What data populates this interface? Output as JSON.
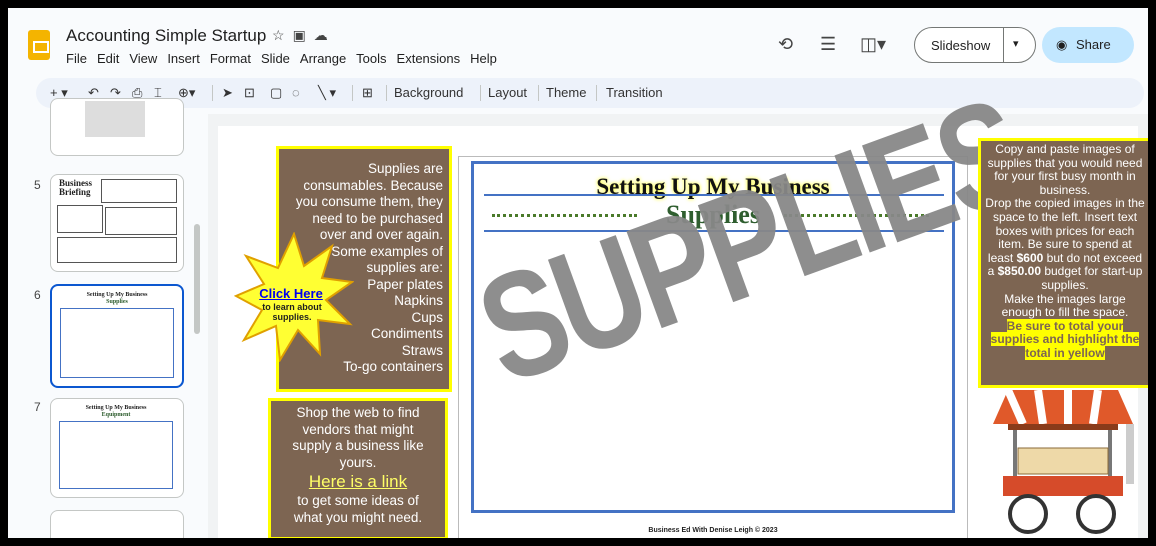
{
  "app": {
    "title": "Accounting Simple Startup",
    "menu": [
      "File",
      "Edit",
      "View",
      "Insert",
      "Format",
      "Slide",
      "Arrange",
      "Tools",
      "Extensions",
      "Help"
    ],
    "slideshow_label": "Slideshow",
    "share_label": "Share",
    "colors": {
      "accent": "#c2e7ff",
      "slide_box": "#7d6552",
      "highlight": "#ffff00",
      "stage_border": "#4472c4"
    }
  },
  "toolbar": {
    "background": "Background",
    "layout": "Layout",
    "theme": "Theme",
    "transition": "Transition"
  },
  "filmstrip": [
    {
      "num": "5",
      "title": "Business Briefing"
    },
    {
      "num": "6",
      "title": "Setting Up My Business",
      "subtitle": "Supplies"
    },
    {
      "num": "7",
      "title": "Setting Up My Business",
      "subtitle": "Equipment"
    }
  ],
  "slide": {
    "left_box_lines": [
      "Supplies are",
      "consumables.  Because",
      "you consume them, they",
      "need to be purchased",
      "over and over again.",
      "Some examples of",
      "supplies are:",
      "Paper plates",
      "Napkins",
      "Cups",
      "Condiments",
      "Straws",
      "To-go containers"
    ],
    "burst_link": "Click Here",
    "burst_text": "to learn about supplies.",
    "shop_lines": [
      "Shop the web to find",
      "vendors that might",
      "supply a business like",
      "yours."
    ],
    "shop_link": "Here is a link",
    "shop_after": [
      "to get some ideas of",
      "what you might need."
    ],
    "heading": "Setting Up My Business",
    "subheading": "Supplies",
    "footer": "Business Ed With Denise Leigh © 2023",
    "watermark": "SUPPLIES",
    "right_box": {
      "p1": "Copy and paste images of supplies that you would need for your first busy month in business.",
      "p2_a": "Drop the copied images in the space to the left. Insert text boxes with prices for each item. Be sure to spend at least ",
      "p2_b": "$600",
      "p2_c": " but do not exceed a ",
      "p2_d": "$850.00",
      "p2_e": " budget for start-up supplies.",
      "p3": "Make the images large enough to fill the space.",
      "p4": "Be sure to total your supplies and highlight the total in yellow"
    }
  }
}
